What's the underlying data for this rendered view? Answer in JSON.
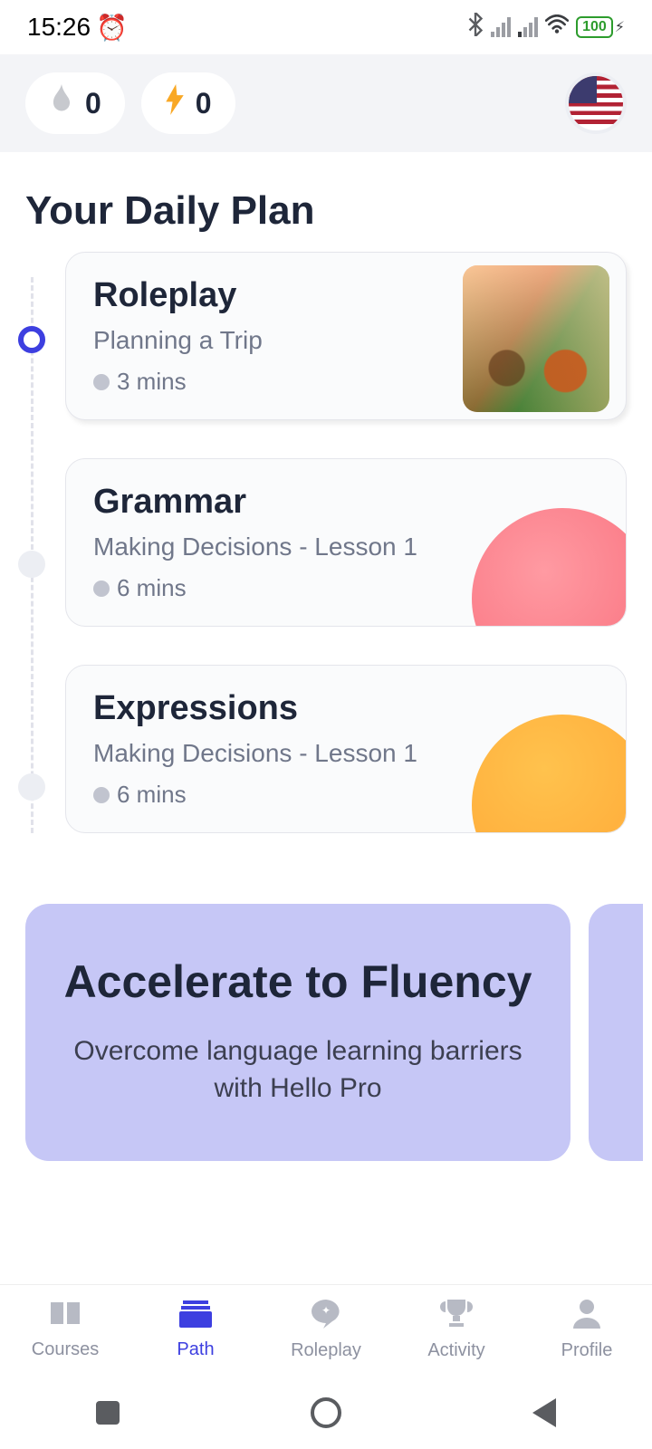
{
  "statusbar": {
    "time": "15:26",
    "battery": "100"
  },
  "header": {
    "streak": "0",
    "bolts": "0"
  },
  "title": "Your Daily Plan",
  "plan": [
    {
      "type": "Roleplay",
      "subtitle": "Planning a Trip",
      "duration": "3 mins"
    },
    {
      "type": "Grammar",
      "subtitle": "Making Decisions - Lesson 1",
      "duration": "6 mins"
    },
    {
      "type": "Expressions",
      "subtitle": "Making Decisions - Lesson 1",
      "duration": "6 mins"
    }
  ],
  "promo": {
    "title": "Accelerate to Fluency",
    "subtitle": "Overcome language learning barriers with Hello Pro"
  },
  "tabs": {
    "courses": "Courses",
    "path": "Path",
    "roleplay": "Roleplay",
    "activity": "Activity",
    "profile": "Profile"
  }
}
